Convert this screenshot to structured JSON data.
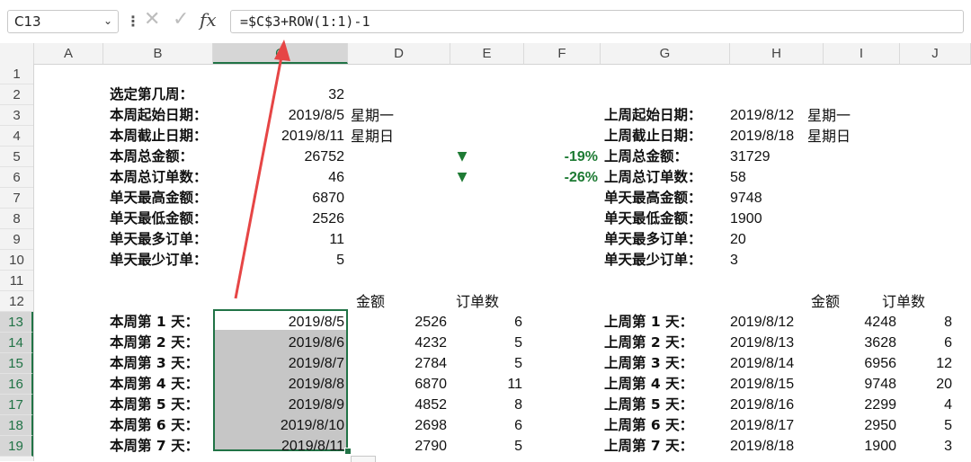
{
  "formula_bar": {
    "name_box": "C13",
    "name_box_chevron": "⌄",
    "separator": "⋮",
    "cancel_icon": "✕",
    "confirm_icon": "✓",
    "fx": "fx",
    "formula": "=$C$3+ROW(1:1)-1"
  },
  "columns": [
    "A",
    "B",
    "C",
    "D",
    "E",
    "F",
    "G",
    "H",
    "I",
    "J"
  ],
  "rows": [
    "1",
    "2",
    "3",
    "4",
    "5",
    "6",
    "7",
    "8",
    "9",
    "10",
    "11",
    "12",
    "13",
    "14",
    "15",
    "16",
    "17",
    "18",
    "19"
  ],
  "selection": {
    "active_cell": "C13",
    "range": "C13:C19"
  },
  "colors": {
    "accent": "#217346",
    "trend_down": "#1e7b34",
    "annotation_arrow": "#e64545",
    "selection_fill": "#c6c6c6"
  },
  "current_week": {
    "rows": [
      {
        "label": "选定第几周：",
        "value": "32",
        "extra": ""
      },
      {
        "label": "本周起始日期：",
        "value": "2019/8/5",
        "extra": "星期一"
      },
      {
        "label": "本周截止日期：",
        "value": "2019/8/11",
        "extra": "星期日"
      },
      {
        "label": "本周总金额：",
        "value": "26752",
        "extra": ""
      },
      {
        "label": "本周总订单数：",
        "value": "46",
        "extra": ""
      },
      {
        "label": "单天最高金额：",
        "value": "6870",
        "extra": ""
      },
      {
        "label": "单天最低金额：",
        "value": "2526",
        "extra": ""
      },
      {
        "label": "单天最多订单：",
        "value": "11",
        "extra": ""
      },
      {
        "label": "单天最少订单：",
        "value": "5",
        "extra": ""
      }
    ]
  },
  "comparison": [
    {
      "arrow": "▼",
      "pct": "-19%"
    },
    {
      "arrow": "▼",
      "pct": "-26%"
    }
  ],
  "last_week": {
    "rows": [
      {
        "label": "上周起始日期：",
        "value": "2019/8/12",
        "extra": "星期一"
      },
      {
        "label": "上周截止日期：",
        "value": "2019/8/18",
        "extra": "星期日"
      },
      {
        "label": "上周总金额：",
        "value": "31729",
        "extra": ""
      },
      {
        "label": "上周总订单数：",
        "value": "58",
        "extra": ""
      },
      {
        "label": "单天最高金额：",
        "value": "9748",
        "extra": ""
      },
      {
        "label": "单天最低金额：",
        "value": "1900",
        "extra": ""
      },
      {
        "label": "单天最多订单：",
        "value": "20",
        "extra": ""
      },
      {
        "label": "单天最少订单：",
        "value": "3",
        "extra": ""
      }
    ]
  },
  "daily_headers": {
    "amount": "金额",
    "orders": "订单数"
  },
  "current_daily": [
    {
      "label": "本周第 1 天：",
      "date": "2019/8/5",
      "amount": "2526",
      "orders": "6"
    },
    {
      "label": "本周第 2 天：",
      "date": "2019/8/6",
      "amount": "4232",
      "orders": "5"
    },
    {
      "label": "本周第 3 天：",
      "date": "2019/8/7",
      "amount": "2784",
      "orders": "5"
    },
    {
      "label": "本周第 4 天：",
      "date": "2019/8/8",
      "amount": "6870",
      "orders": "11"
    },
    {
      "label": "本周第 5 天：",
      "date": "2019/8/9",
      "amount": "4852",
      "orders": "8"
    },
    {
      "label": "本周第 6 天：",
      "date": "2019/8/10",
      "amount": "2698",
      "orders": "6"
    },
    {
      "label": "本周第 7 天：",
      "date": "2019/8/11",
      "amount": "2790",
      "orders": "5"
    }
  ],
  "last_daily": [
    {
      "label": "上周第 1 天：",
      "date": "2019/8/12",
      "amount": "4248",
      "orders": "8"
    },
    {
      "label": "上周第 2 天：",
      "date": "2019/8/13",
      "amount": "3628",
      "orders": "6"
    },
    {
      "label": "上周第 3 天：",
      "date": "2019/8/14",
      "amount": "6956",
      "orders": "12"
    },
    {
      "label": "上周第 4 天：",
      "date": "2019/8/15",
      "amount": "9748",
      "orders": "20"
    },
    {
      "label": "上周第 5 天：",
      "date": "2019/8/16",
      "amount": "2299",
      "orders": "4"
    },
    {
      "label": "上周第 6 天：",
      "date": "2019/8/17",
      "amount": "2950",
      "orders": "5"
    },
    {
      "label": "上周第 7 天：",
      "date": "2019/8/18",
      "amount": "1900",
      "orders": "3"
    }
  ]
}
